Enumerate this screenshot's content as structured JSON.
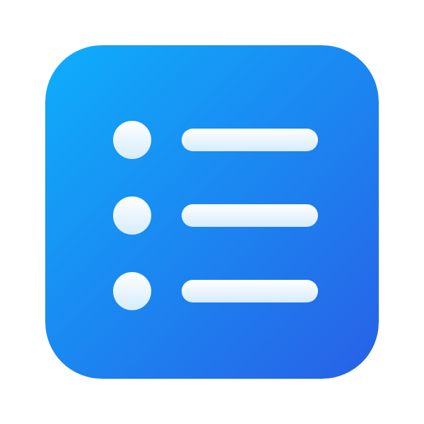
{
  "icon": {
    "name": "list-icon",
    "rows": 3,
    "colors": {
      "gradient_start": "#0EAEFC",
      "gradient_end": "#2860E6",
      "glyph_top": "#FFFFFF",
      "glyph_bottom": "#D6ECFC"
    }
  }
}
